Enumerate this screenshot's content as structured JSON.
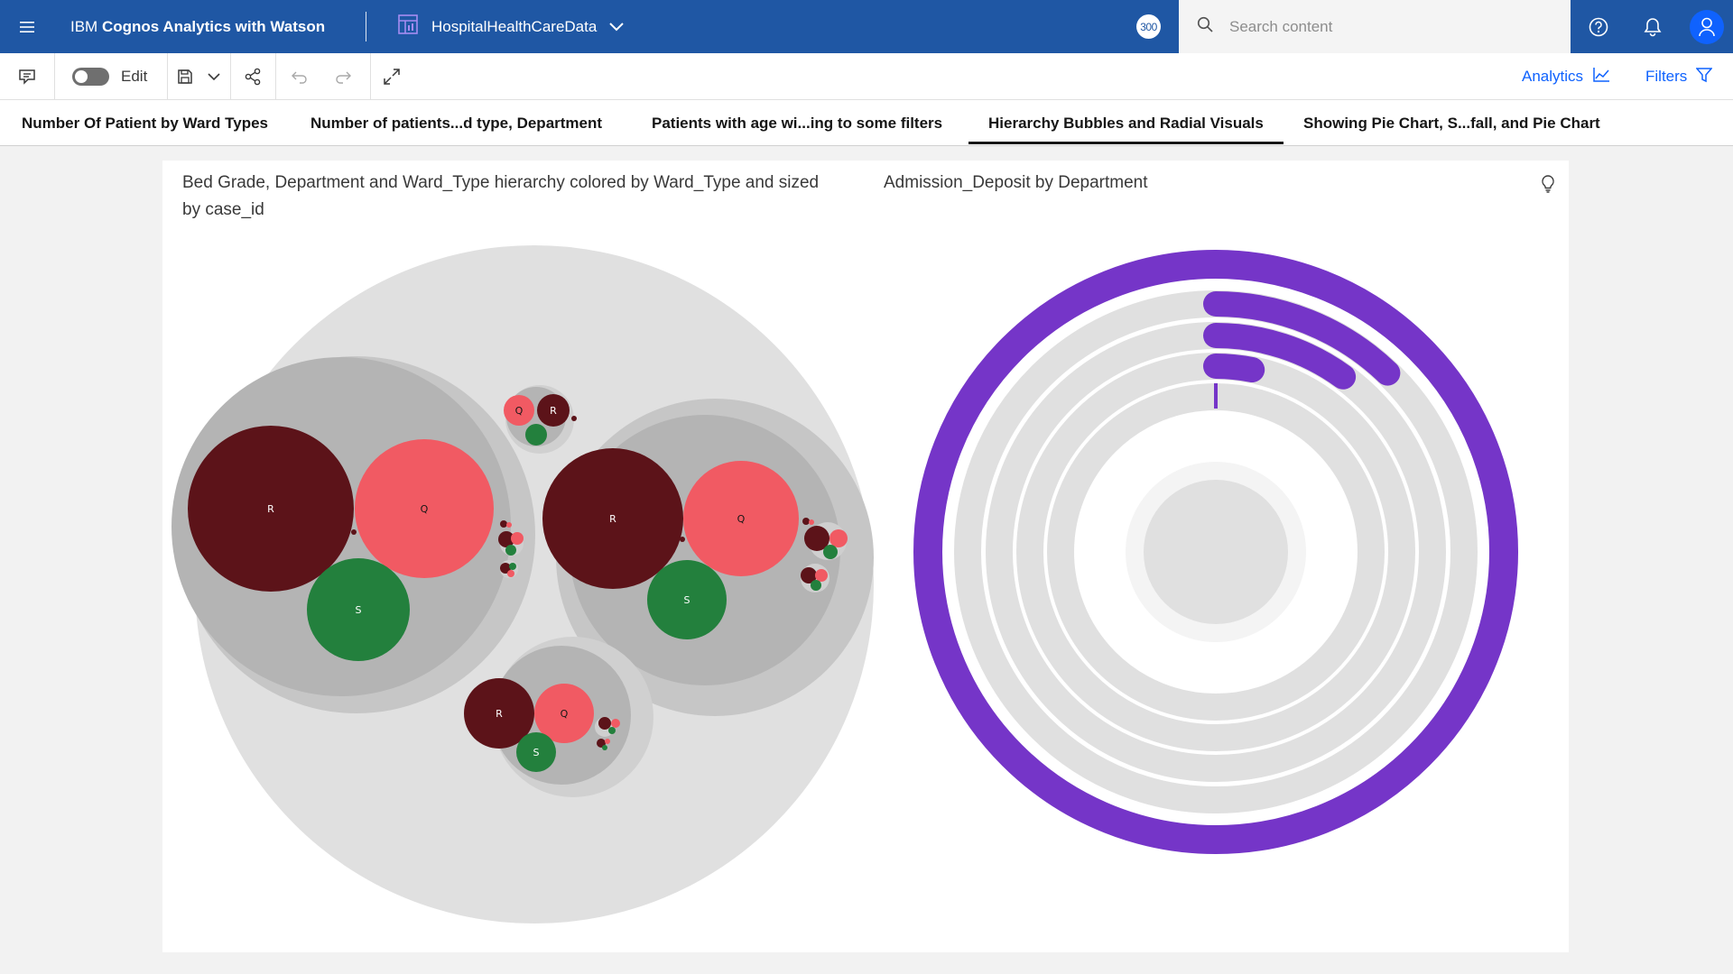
{
  "header": {
    "product_prefix": "IBM ",
    "product_name": "Cognos Analytics with Watson",
    "source_name": "HospitalHealthCareData",
    "badge": "300",
    "search_placeholder": "Search content"
  },
  "toolbar": {
    "edit_label": "Edit",
    "analytics_label": "Analytics",
    "filters_label": "Filters"
  },
  "tabs": [
    {
      "label": "Number Of Patient by Ward Types"
    },
    {
      "label": "Number of patients...d type, Department"
    },
    {
      "label": "Patients with age wi...ing to some filters"
    },
    {
      "label": "Hierarchy Bubbles and Radial Visuals"
    },
    {
      "label": "Showing Pie Chart, S...fall, and Pie Chart"
    }
  ],
  "active_tab": 3,
  "colors": {
    "topbar": "#1f57a4",
    "ward_R": "#5c1319",
    "ward_Q": "#f15a63",
    "ward_S": "#23803d",
    "radial_accent": "#7535c8"
  },
  "visuals": {
    "left_title": "Bed Grade, Department and Ward_Type hierarchy colored by Ward_Type and sized by case_id",
    "right_title": "Admission_Deposit by Department"
  },
  "chart_data": [
    {
      "type": "circle-packing",
      "title": "Bed Grade, Department and Ward_Type hierarchy colored by Ward_Type and sized by case_id",
      "color_by": "Ward_Type",
      "size_by": "case_id",
      "groups": [
        {
          "leaves": [
            {
              "label": "R",
              "relative_size": 1.0
            },
            {
              "label": "Q",
              "relative_size": 0.72
            },
            {
              "label": "S",
              "relative_size": 0.39
            }
          ]
        },
        {
          "leaves": [
            {
              "label": "R",
              "relative_size": 0.9
            },
            {
              "label": "Q",
              "relative_size": 0.62
            },
            {
              "label": "S",
              "relative_size": 0.29
            }
          ]
        },
        {
          "leaves": [
            {
              "label": "R",
              "relative_size": 0.2
            },
            {
              "label": "Q",
              "relative_size": 0.15
            },
            {
              "label": "S",
              "relative_size": 0.08
            }
          ]
        },
        {
          "leaves": [
            {
              "label": "Q",
              "relative_size": 0.05
            },
            {
              "label": "R",
              "relative_size": 0.05
            },
            {
              "label": "S",
              "relative_size": 0.03
            }
          ]
        }
      ]
    },
    {
      "type": "radial-bar",
      "title": "Admission_Deposit by Department",
      "arc_fractions": [
        1.0,
        0.18,
        0.14,
        0.05,
        0.003
      ]
    }
  ]
}
